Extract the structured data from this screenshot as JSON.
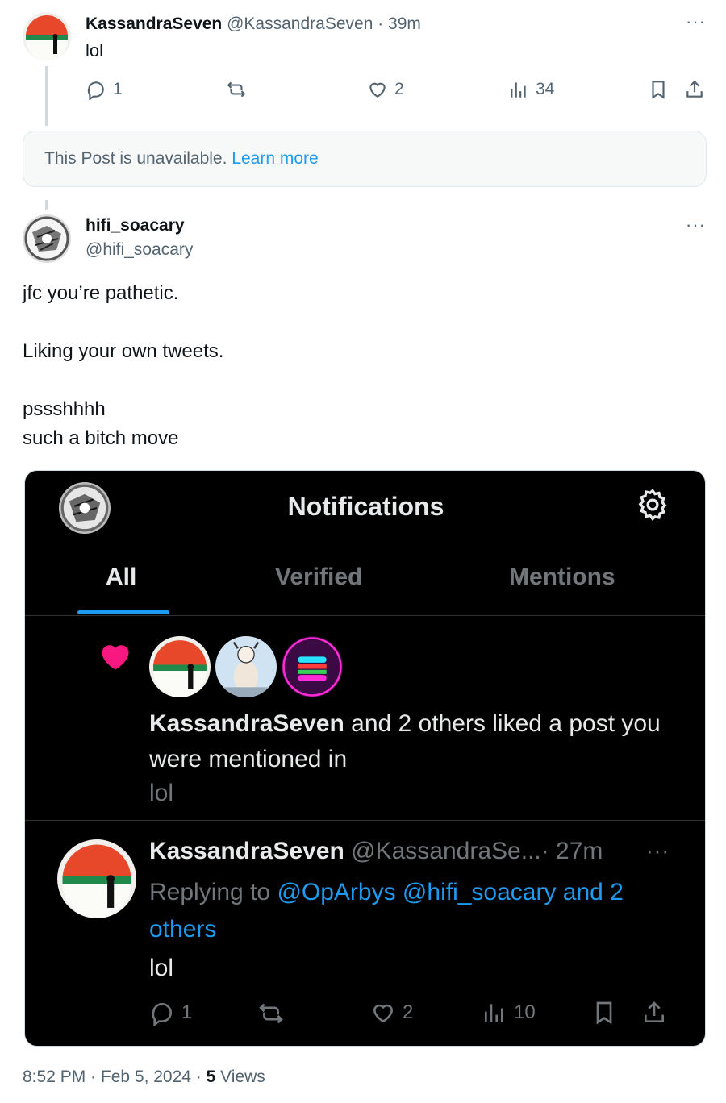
{
  "tweet1": {
    "display_name": "KassandraSeven",
    "handle": "@KassandraSeven",
    "time": "· 39m",
    "text": "lol",
    "replies": "1",
    "likes": "2",
    "views": "34"
  },
  "unavailable_card": {
    "text": "This Post is unavailable.",
    "link": "Learn more"
  },
  "tweet2": {
    "display_name": "hifi_soacary",
    "handle": "@hifi_soacary",
    "lines": [
      "jfc you’re pathetic.",
      "",
      "Liking your own tweets.",
      "",
      "pssshhhh",
      "such a bitch move"
    ]
  },
  "screenshot": {
    "header_title": "Notifications",
    "tabs": [
      "All",
      "Verified",
      "Mentions"
    ],
    "notification": {
      "actor": "KassandraSeven",
      "rest": " and 2 others liked a post you were mentioned in",
      "snippet": "lol"
    },
    "reply": {
      "display_name": "KassandraSeven",
      "handle": "@KassandraSe...",
      "time": "· 27m",
      "replying_prefix": "Replying to ",
      "replying_to": "@OpArbys @hifi_soacary and 2 others",
      "text": "lol",
      "replies": "1",
      "likes": "2",
      "views": "10"
    }
  },
  "meta": {
    "timestamp": "8:52 PM · Feb 5, 2024 · ",
    "views_count": "5",
    "views_label": " Views"
  },
  "colors": {
    "accent": "#1d9bf0",
    "like_pink": "#f91880",
    "muted": "#536471"
  }
}
